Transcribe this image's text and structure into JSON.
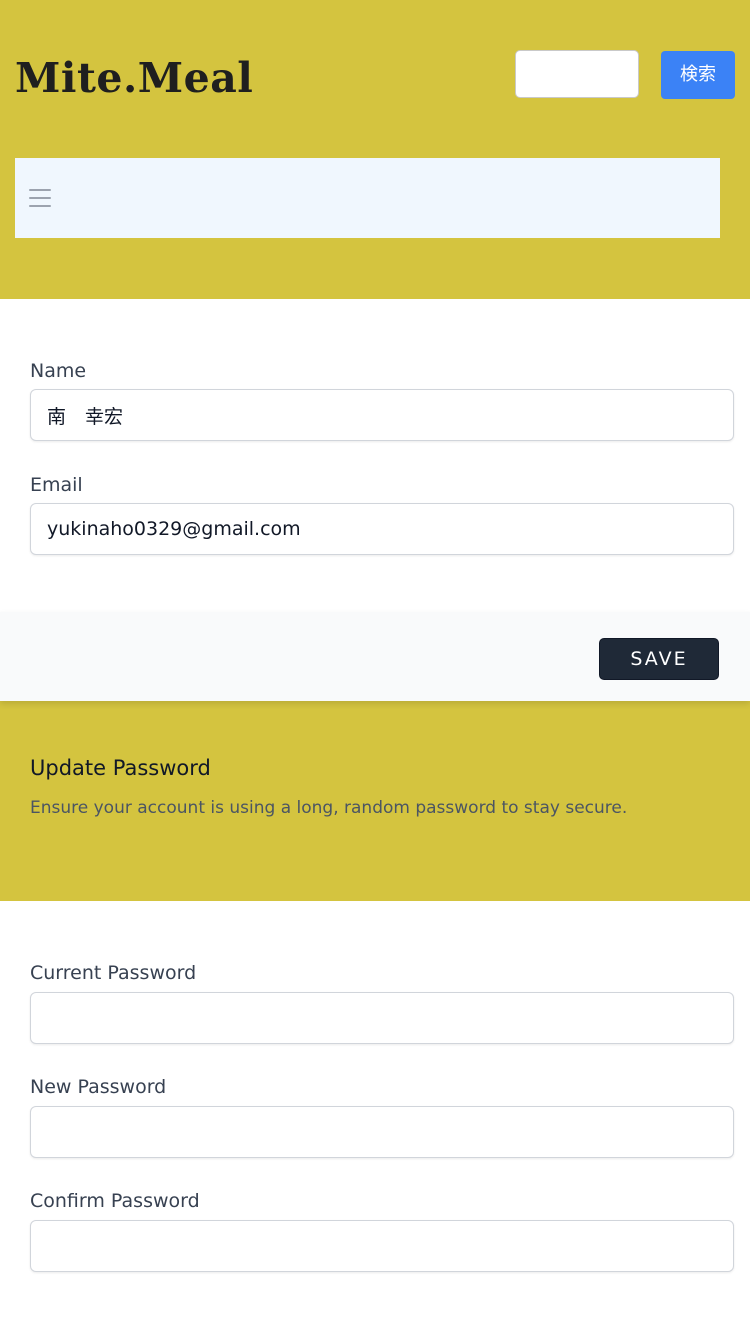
{
  "header": {
    "logo": "Mite.Meal",
    "search": {
      "value": "",
      "placeholder": "",
      "button_label": "検索"
    }
  },
  "profile": {
    "name_label": "Name",
    "name_value": "南　幸宏",
    "email_label": "Email",
    "email_value": "yukinaho0329@gmail.com",
    "save_label": "SAVE"
  },
  "password": {
    "title": "Update Password",
    "description": "Ensure your account is using a long, random password to stay secure.",
    "current_label": "Current Password",
    "current_value": "",
    "new_label": "New Password",
    "new_value": "",
    "confirm_label": "Confirm Password",
    "confirm_value": ""
  },
  "colors": {
    "brand_background": "#d4c43f",
    "search_button": "#3b82f6",
    "save_button": "#1f2937"
  },
  "icons": {
    "menu": "hamburger-menu-icon"
  }
}
